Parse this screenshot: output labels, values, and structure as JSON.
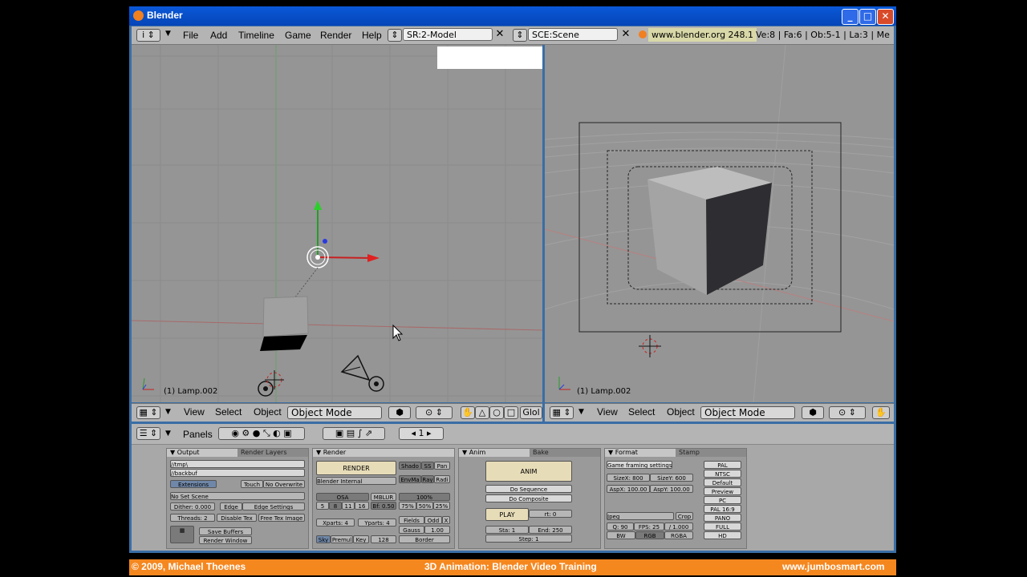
{
  "window": {
    "title": "Blender"
  },
  "header": {
    "menu": [
      "File",
      "Add",
      "Timeline",
      "Game",
      "Render",
      "Help"
    ],
    "screen": "SR:2-Model",
    "scene": "SCE:Scene",
    "url": "www.blender.org 248.1",
    "stats": "Ve:8 | Fa:6 | Ob:5-1 | La:3 | Me"
  },
  "viewport_left": {
    "label": "(1) Lamp.002",
    "menus": [
      "View",
      "Select",
      "Object"
    ],
    "mode": "Object Mode",
    "orient": "Glol"
  },
  "viewport_right": {
    "label": "(1) Lamp.002",
    "menus": [
      "View",
      "Select",
      "Object"
    ],
    "mode": "Object Mode"
  },
  "buttons_header": {
    "panels_label": "Panels",
    "frame": "1"
  },
  "panel_output": {
    "tabs": [
      "Output",
      "Render Layers"
    ],
    "path1": "//tmp\\",
    "path2": "//backbuf",
    "extensions": "Extensions",
    "touch": "Touch",
    "no_overwrite": "No Overwrite",
    "no_set_scene": "No Set Scene",
    "dither": "Dither: 0.000",
    "edge": "Edge",
    "edge_settings": "Edge Settings",
    "threads": "Threads: 2",
    "disable_tex": "Disable Tex",
    "free_tex": "Free Tex Image",
    "save_buffers": "Save Buffers",
    "render_window": "Render Window"
  },
  "panel_render": {
    "tab": "Render",
    "render": "RENDER",
    "engine": "Blender Internal",
    "shadow": "Shado",
    "sss": "SS",
    "pan": "Pan",
    "envmap": "EnvMa",
    "ray": "Ray",
    "radio": "Radi",
    "osa": "OSA",
    "mblur": "MBLUR",
    "pct100": "100%",
    "osa_vals": [
      "5",
      "8",
      "11",
      "16"
    ],
    "bf": "Bf: 0.50",
    "pcts": [
      "75%",
      "50%",
      "25%"
    ],
    "xparts": "Xparts: 4",
    "yparts": "Yparts: 4",
    "fields": "Fields",
    "odd": "Odd",
    "x": "X",
    "gauss": "Gauss",
    "gauss_val": "1.00",
    "sky": "Sky",
    "premul": "Premul",
    "key": "Key",
    "size128": "128",
    "border": "Border"
  },
  "panel_anim": {
    "tabs": [
      "Anim",
      "Bake"
    ],
    "anim": "ANIM",
    "do_sequence": "Do Sequence",
    "do_composite": "Do Composite",
    "play": "PLAY",
    "rt": "rt: 0",
    "sta": "Sta: 1",
    "end": "End: 250",
    "step": "Step: 1"
  },
  "panel_format": {
    "tabs": [
      "Format",
      "Stamp"
    ],
    "game_framing": "Game framing settings",
    "sizex": "SizeX: 800",
    "sizey": "SizeY: 600",
    "aspx": "AspX: 100.00",
    "aspy": "AspY: 100.00",
    "presets": [
      "PAL",
      "NTSC",
      "Default",
      "Preview",
      "PC",
      "PAL 16:9",
      "PANO",
      "FULL",
      "HD"
    ],
    "jpeg": "Jpeg",
    "crop": "Crop",
    "quality": "Q: 90",
    "fps": "FPS: 25",
    "fps_base": "/ 1.000",
    "bw": "BW",
    "rgb": "RGB",
    "rgba": "RGBA"
  },
  "footer": {
    "left": "© 2009, Michael Thoenes",
    "center": "3D Animation: Blender Video Training",
    "right": "www.jumbosmart.com"
  }
}
